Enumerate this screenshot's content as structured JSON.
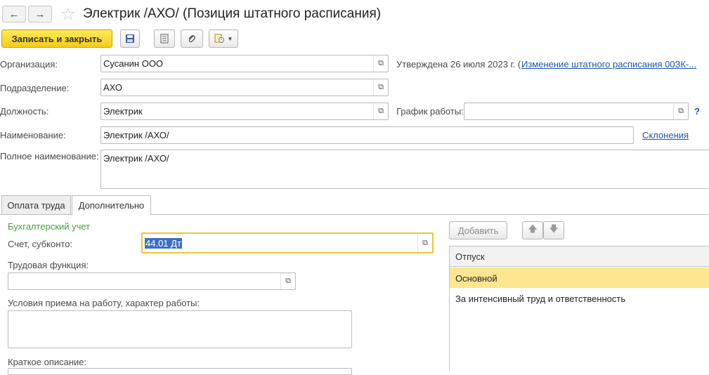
{
  "window": {
    "title": "Электрик /АХО/ (Позиция штатного расписания)",
    "back_icon": "arrow-left-icon",
    "forward_icon": "arrow-right-icon",
    "favorite_icon": "star-icon"
  },
  "toolbar": {
    "save_close_label": "Записать и закрыть",
    "save_icon": "floppy-disk-icon",
    "report_icon": "document-list-icon",
    "attach_icon": "paperclip-icon",
    "create_based_icon": "create-based-icon"
  },
  "form": {
    "organization_label": "Организация:",
    "organization_value": "Сусанин ООО",
    "approved_text": "Утверждена 26 июля 2023 г. (",
    "approved_link": "Изменение штатного расписания 00ЗК-...",
    "department_label": "Подразделение:",
    "department_value": "АХО",
    "position_label": "Должность:",
    "position_value": "Электрик",
    "schedule_label": "График работы:",
    "schedule_value": "",
    "help_mark": "?",
    "name_label": "Наименование:",
    "name_value": "Электрик /АХО/",
    "declension_link": "Склонения",
    "full_name_label": "Полное наименование:",
    "full_name_value": "Электрик /АХО/"
  },
  "tabs": [
    {
      "label": "Оплата труда"
    },
    {
      "label": "Дополнительно"
    }
  ],
  "additional": {
    "accounting_section": "Бухгалтерский учет",
    "account_label": "Счет, субконто:",
    "account_value": "44.01 Дт",
    "labor_function_label": "Трудовая функция:",
    "labor_function_value": "",
    "conditions_label": "Условия приема на работу, характер работы:",
    "conditions_value": "",
    "short_desc_label": "Краткое описание:"
  },
  "vacation": {
    "add_label": "Добавить",
    "column_header": "Отпуск",
    "rows": [
      {
        "label": "Основной"
      },
      {
        "label": "За интенсивный труд и ответственность"
      }
    ]
  },
  "colors": {
    "accent_yellow": "#f3cc1a",
    "link_blue": "#1b58ad",
    "section_green": "#4b9e43",
    "selected_row": "#fde68f"
  }
}
